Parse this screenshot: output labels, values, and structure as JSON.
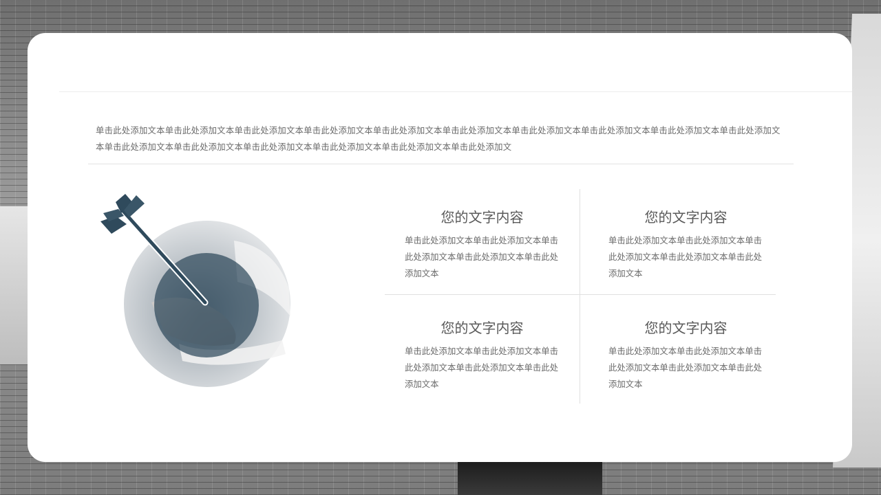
{
  "intro": {
    "text": "单击此处添加文本单击此处添加文本单击此处添加文本单击此处添加文本单击此处添加文本单击此处添加文本单击此处添加文本单击此处添加文本单击此处添加文本单击此处添加文本单击此处添加文本单击此处添加文本单击此处添加文本单击此处添加文本单击此处添加文本单击此处添加文"
  },
  "blocks": [
    {
      "title": "您的文字内容",
      "body": "单击此处添加文本单击此处添加文本单击此处添加文本单击此处添加文本单击此处添加文本"
    },
    {
      "title": "您的文字内容",
      "body": "单击此处添加文本单击此处添加文本单击此处添加文本单击此处添加文本单击此处添加文本"
    },
    {
      "title": "您的文字内容",
      "body": "单击此处添加文本单击此处添加文本单击此处添加文本单击此处添加文本单击此处添加文本"
    },
    {
      "title": "您的文字内容",
      "body": "单击此处添加文本单击此处添加文本单击此处添加文本单击此处添加文本单击此处添加文本"
    }
  ],
  "colors": {
    "accent": "#2f4a5c",
    "text": "#6a6a6a",
    "title": "#595959"
  },
  "icons": {
    "illustration": "target-arrow-icon"
  }
}
